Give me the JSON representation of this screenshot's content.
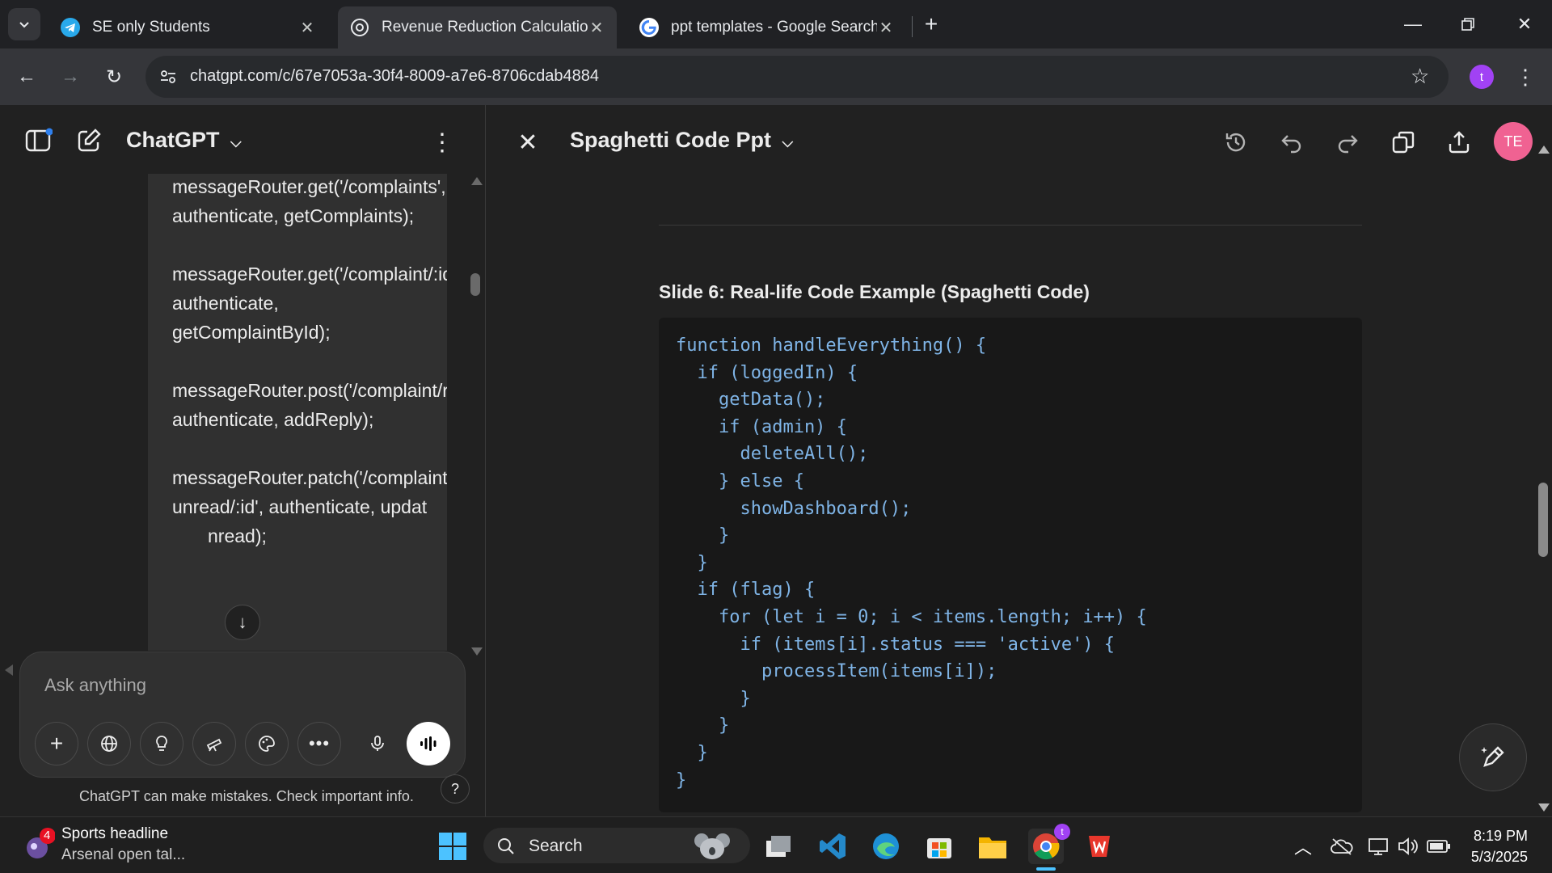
{
  "browser": {
    "tabs": [
      {
        "title": "SE only Students",
        "icon": "telegram-icon",
        "active": false
      },
      {
        "title": "Revenue Reduction Calculation",
        "icon": "chatgpt-icon",
        "active": true
      },
      {
        "title": "ppt templates - Google Search",
        "icon": "google-icon",
        "active": false
      }
    ],
    "url": "chatgpt.com/c/67e7053a-30f4-8009-a7e6-8706cdab4884",
    "profile_initial": "t"
  },
  "chat": {
    "app_title": "ChatGPT",
    "message_lines": [
      "messageRouter.get('/complaints', authenticate, getComplaints);",
      "messageRouter.get('/complaint/:id', authenticate, getComplaintById);",
      "messageRouter.post('/complaint/reply/:id', authenticate, addReply);",
      "messageRouter.patch('/complaint/is-unread/:id', authenticate, updat",
      "nread);"
    ],
    "composer_placeholder": "Ask anything",
    "disclaimer": "ChatGPT can make mistakes. Check important info.",
    "help_label": "?"
  },
  "canvas": {
    "title": "Spaghetti Code Ppt",
    "avatar_initials": "TE",
    "slide_heading": "Slide 6: Real-life Code Example (Spaghetti Code)",
    "code": "function handleEverything() {\n  if (loggedIn) {\n    getData();\n    if (admin) {\n      deleteAll();\n    } else {\n      showDashboard();\n    }\n  }\n  if (flag) {\n    for (let i = 0; i < items.length; i++) {\n      if (items[i].status === 'active') {\n        processItem(items[i]);\n      }\n    }\n  }\n}"
  },
  "taskbar": {
    "news_badge": "4",
    "news_title": "Sports headline",
    "news_subtitle": "Arsenal open tal...",
    "search_label": "Search",
    "chrome_badge": "t",
    "time": "8:19 PM",
    "date": "5/3/2025"
  },
  "colors": {
    "accent_avatar": "#f06292",
    "profile": "#a142f4",
    "code_text": "#7fb4e6"
  }
}
